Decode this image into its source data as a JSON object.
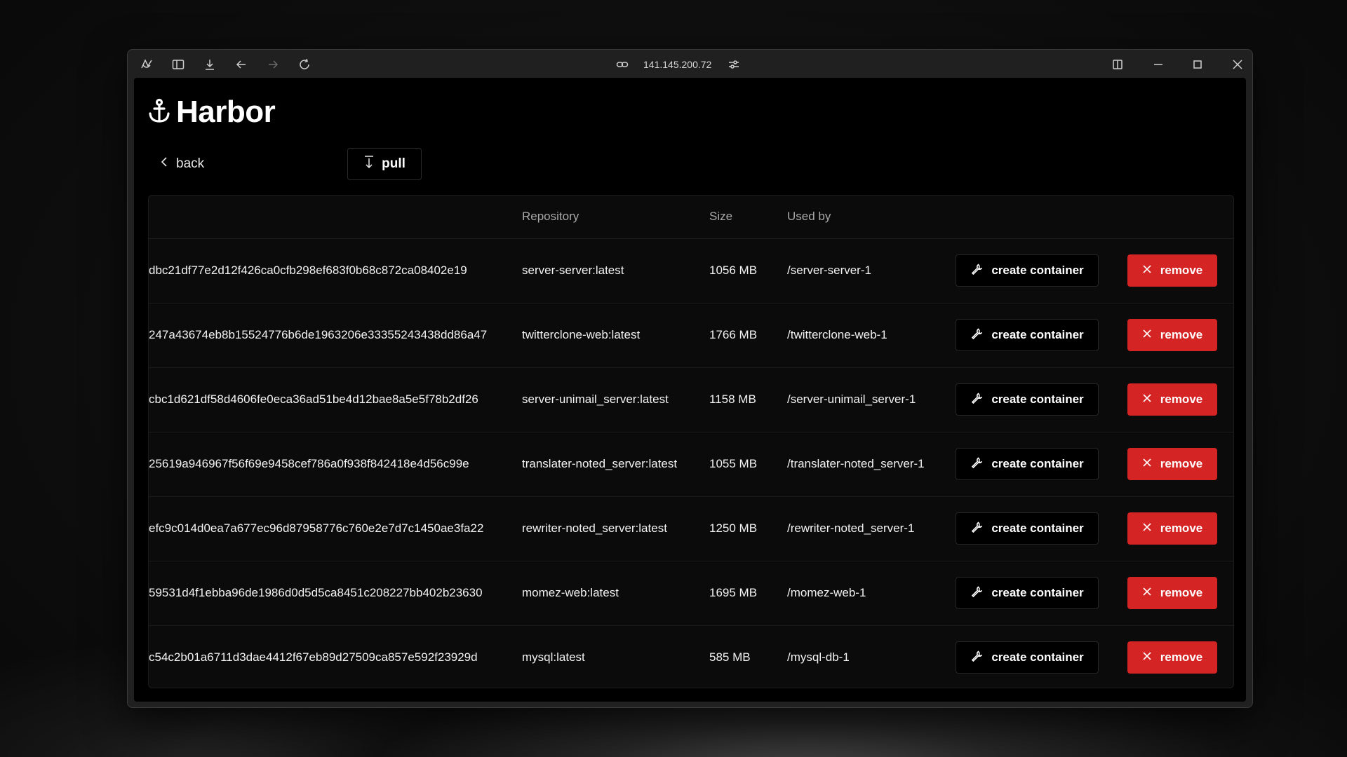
{
  "browser": {
    "url": "141.145.200.72",
    "icons": [
      "browser-logo-icon",
      "sidebar-toggle-icon",
      "download-icon",
      "back-arrow-icon",
      "forward-arrow-icon",
      "reload-icon",
      "link-icon",
      "site-settings-icon",
      "split-view-icon",
      "minimize-icon",
      "maximize-icon",
      "close-icon"
    ]
  },
  "app": {
    "name": "Harbor",
    "logo_icon": "anchor-icon"
  },
  "nav": {
    "back_label": "back",
    "pull_label": "pull"
  },
  "table": {
    "headers": {
      "repository": "Repository",
      "size": "Size",
      "used_by": "Used by"
    },
    "rows": [
      {
        "id": "dbc21df77e2d12f426ca0cfb298ef683f0b68c872ca08402e19",
        "repository": "server-server:latest",
        "size": "1056 MB",
        "used_by": "/server-server-1",
        "create_label": "create container",
        "remove_label": "remove"
      },
      {
        "id": "247a43674eb8b15524776b6de1963206e33355243438dd86a47",
        "repository": "twitterclone-web:latest",
        "size": "1766 MB",
        "used_by": "/twitterclone-web-1",
        "create_label": "create container",
        "remove_label": "remove"
      },
      {
        "id": "cbc1d621df58d4606fe0eca36ad51be4d12bae8a5e5f78b2df26",
        "repository": "server-unimail_server:latest",
        "size": "1158 MB",
        "used_by": "/server-unimail_server-1",
        "create_label": "create container",
        "remove_label": "remove"
      },
      {
        "id": "25619a946967f56f69e9458cef786a0f938f842418e4d56c99e",
        "repository": "translater-noted_server:latest",
        "size": "1055 MB",
        "used_by": "/translater-noted_server-1",
        "create_label": "create container",
        "remove_label": "remove"
      },
      {
        "id": "efc9c014d0ea7a677ec96d87958776c760e2e7d7c1450ae3fa22",
        "repository": "rewriter-noted_server:latest",
        "size": "1250 MB",
        "used_by": "/rewriter-noted_server-1",
        "create_label": "create container",
        "remove_label": "remove"
      },
      {
        "id": "59531d4f1ebba96de1986d0d5d5ca8451c208227bb402b23630",
        "repository": "momez-web:latest",
        "size": "1695 MB",
        "used_by": "/momez-web-1",
        "create_label": "create container",
        "remove_label": "remove"
      },
      {
        "id": "c54c2b01a6711d3dae4412f67eb89d27509ca857e592f23929d",
        "repository": "mysql:latest",
        "size": "585 MB",
        "used_by": "/mysql-db-1",
        "create_label": "create container",
        "remove_label": "remove"
      }
    ]
  },
  "colors": {
    "remove": "#d42424",
    "background": "#000000",
    "text": "#ffffff"
  }
}
